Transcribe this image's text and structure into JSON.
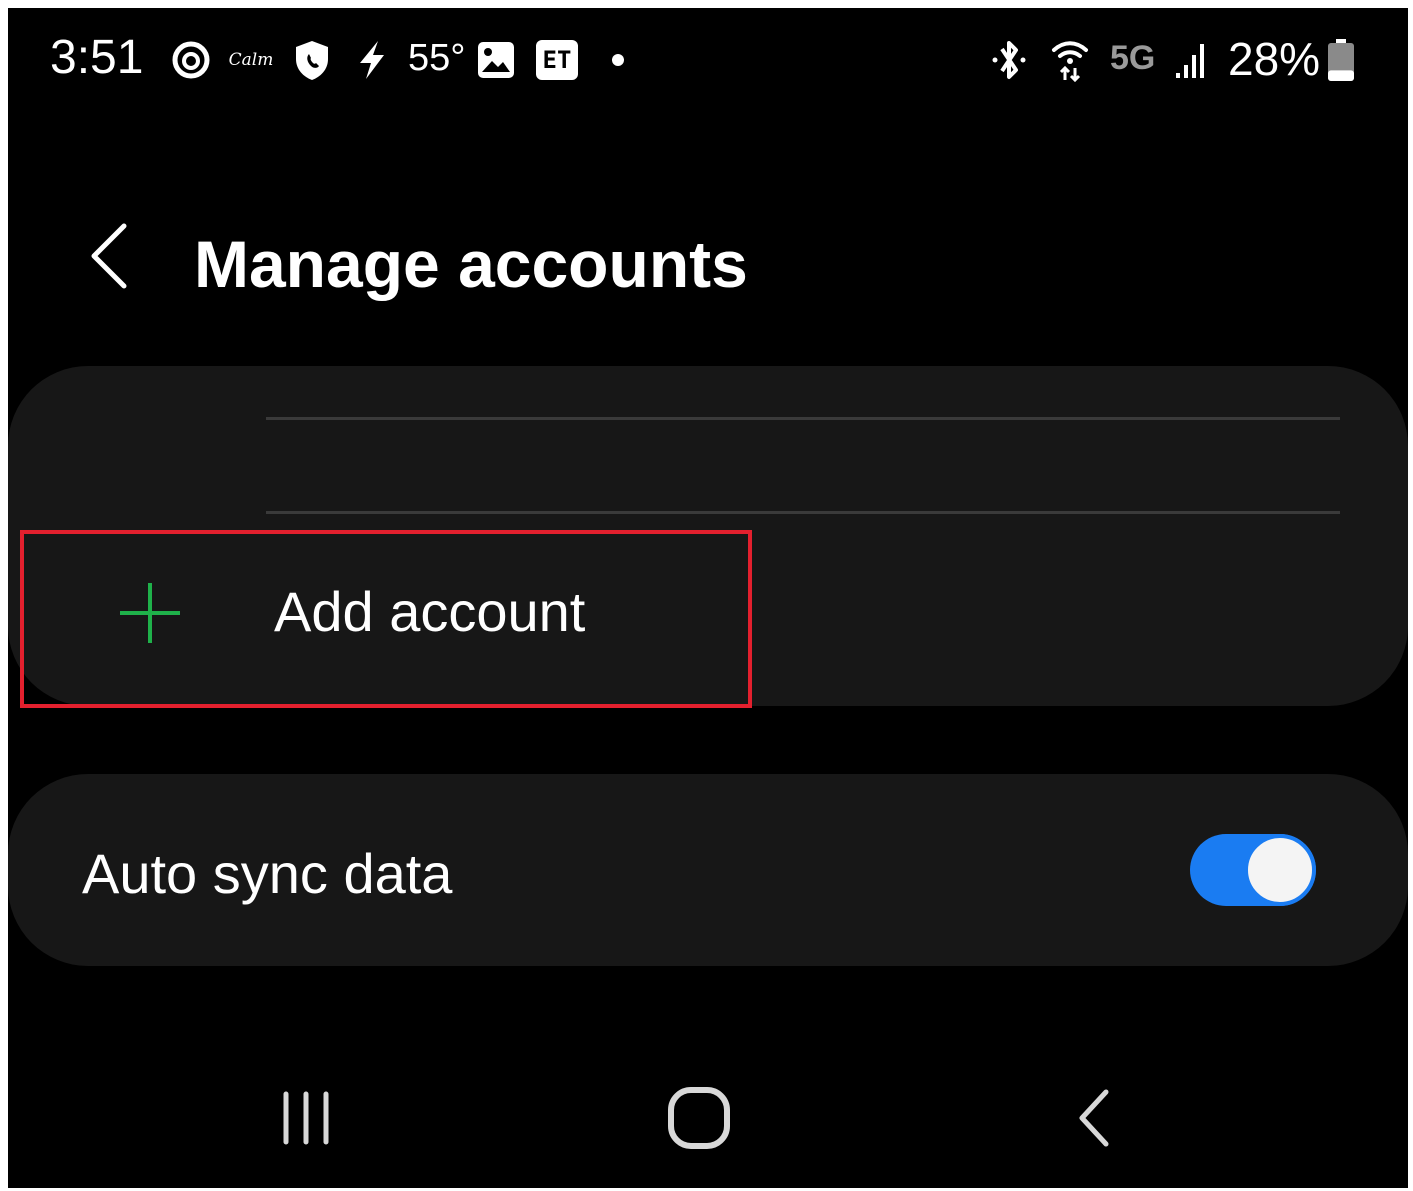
{
  "status_bar": {
    "time": "3:51",
    "calm_label": "Calm",
    "temperature": "55°",
    "et_badge": "ET",
    "network": "5G",
    "battery_percent": "28%",
    "battery_level": 0.28,
    "icons": [
      "threads-icon",
      "calm-icon",
      "shield-icon",
      "lightning-icon",
      "image-icon",
      "et-icon",
      "notification-dot-icon",
      "bluetooth-icon",
      "wifi-icon",
      "signal-icon",
      "battery-icon"
    ]
  },
  "header": {
    "title": "Manage accounts",
    "back_icon": "chevron-left-icon"
  },
  "accounts": {
    "add_account_label": "Add account",
    "add_icon": "plus-icon",
    "add_icon_color": "#1fb14a",
    "highlight_color": "#e3202e"
  },
  "settings": {
    "auto_sync_label": "Auto sync data",
    "auto_sync_enabled": true,
    "toggle_color": "#1a7cf2"
  },
  "nav_bar": {
    "icons": [
      "recents-icon",
      "home-icon",
      "back-icon"
    ]
  }
}
